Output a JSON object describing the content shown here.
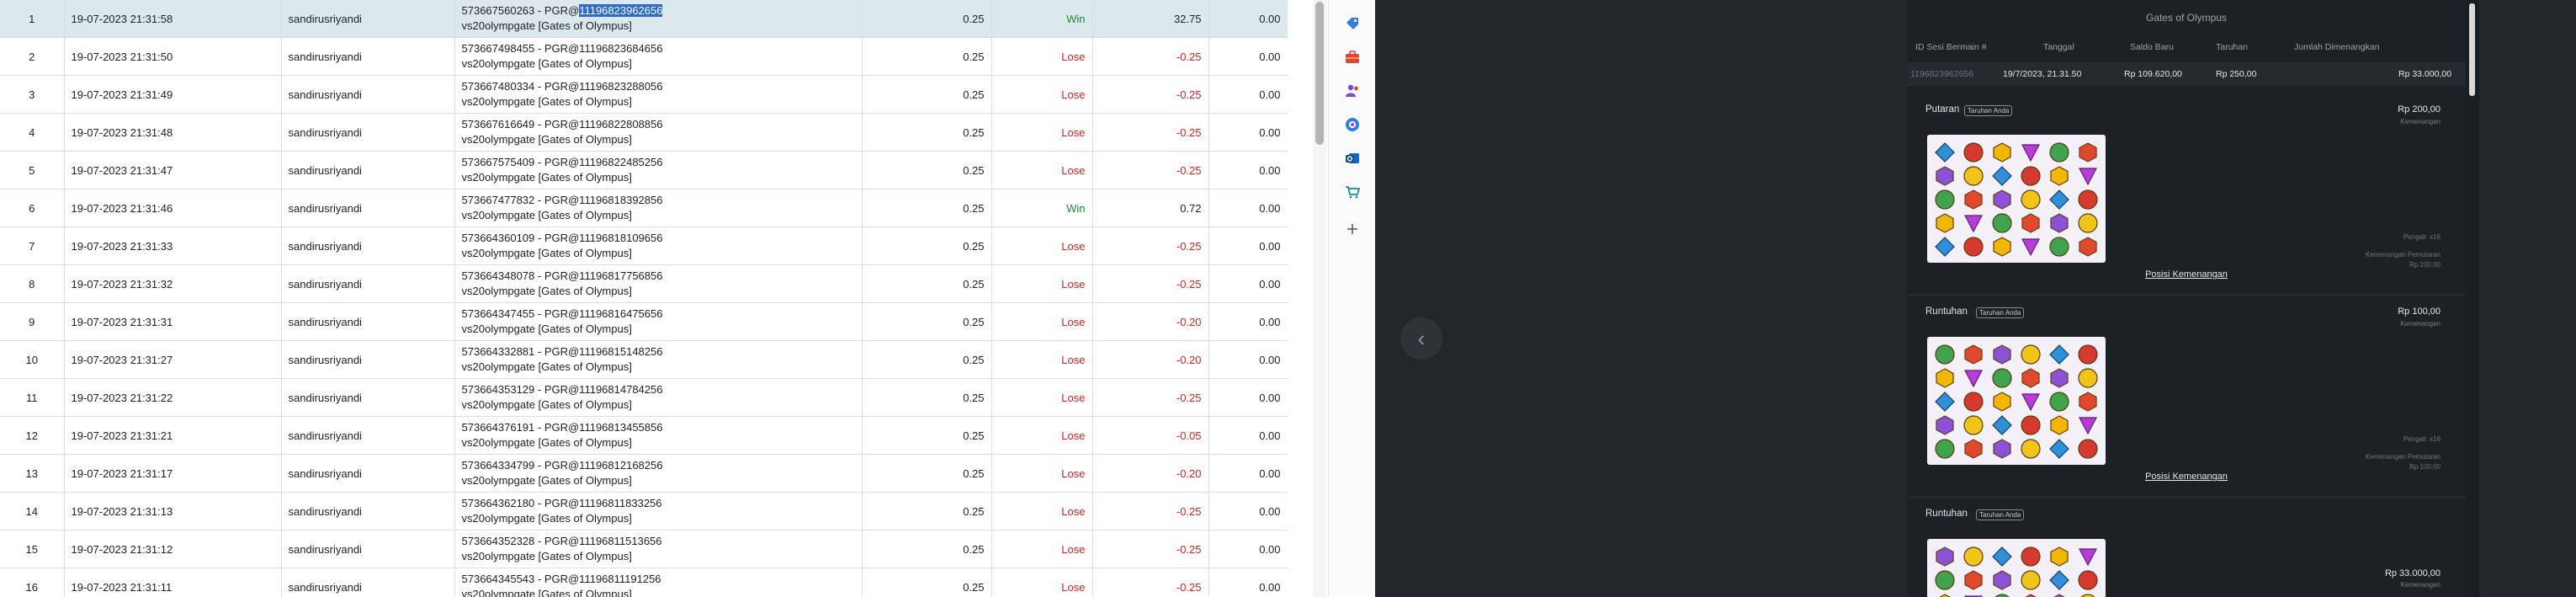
{
  "table": {
    "rows": [
      {
        "no": "1",
        "date": "19-07-2023 21:31:58",
        "user": "sandirusriyandi",
        "game_pre": "573667560263 - PGR@",
        "game_hl": "11196823962656",
        "game_post": "",
        "game_line2": "vs20olympgate [Gates of Olympus]",
        "bet": "0.25",
        "result": "Win",
        "amount": "32.75",
        "balance": "0.00"
      },
      {
        "no": "2",
        "date": "19-07-2023 21:31:50",
        "user": "sandirusriyandi",
        "game_pre": "573667498455 - PGR@11196823684656",
        "game_hl": "",
        "game_post": "",
        "game_line2": "vs20olympgate [Gates of Olympus]",
        "bet": "0.25",
        "result": "Lose",
        "amount": "-0.25",
        "balance": "0.00"
      },
      {
        "no": "3",
        "date": "19-07-2023 21:31:49",
        "user": "sandirusriyandi",
        "game_pre": "573667480334 - PGR@11196823288056",
        "game_hl": "",
        "game_post": "",
        "game_line2": "vs20olympgate [Gates of Olympus]",
        "bet": "0.25",
        "result": "Lose",
        "amount": "-0.25",
        "balance": "0.00"
      },
      {
        "no": "4",
        "date": "19-07-2023 21:31:48",
        "user": "sandirusriyandi",
        "game_pre": "573667616649 - PGR@11196822808856",
        "game_hl": "",
        "game_post": "",
        "game_line2": "vs20olympgate [Gates of Olympus]",
        "bet": "0.25",
        "result": "Lose",
        "amount": "-0.25",
        "balance": "0.00"
      },
      {
        "no": "5",
        "date": "19-07-2023 21:31:47",
        "user": "sandirusriyandi",
        "game_pre": "573667575409 - PGR@11196822485256",
        "game_hl": "",
        "game_post": "",
        "game_line2": "vs20olympgate [Gates of Olympus]",
        "bet": "0.25",
        "result": "Lose",
        "amount": "-0.25",
        "balance": "0.00"
      },
      {
        "no": "6",
        "date": "19-07-2023 21:31:46",
        "user": "sandirusriyandi",
        "game_pre": "573667477832 - PGR@11196818392856",
        "game_hl": "",
        "game_post": "",
        "game_line2": "vs20olympgate [Gates of Olympus]",
        "bet": "0.25",
        "result": "Win",
        "amount": "0.72",
        "balance": "0.00"
      },
      {
        "no": "7",
        "date": "19-07-2023 21:31:33",
        "user": "sandirusriyandi",
        "game_pre": "573664360109 - PGR@11196818109656",
        "game_hl": "",
        "game_post": "",
        "game_line2": "vs20olympgate [Gates of Olympus]",
        "bet": "0.25",
        "result": "Lose",
        "amount": "-0.25",
        "balance": "0.00"
      },
      {
        "no": "8",
        "date": "19-07-2023 21:31:32",
        "user": "sandirusriyandi",
        "game_pre": "573664348078 - PGR@11196817756856",
        "game_hl": "",
        "game_post": "",
        "game_line2": "vs20olympgate [Gates of Olympus]",
        "bet": "0.25",
        "result": "Lose",
        "amount": "-0.25",
        "balance": "0.00"
      },
      {
        "no": "9",
        "date": "19-07-2023 21:31:31",
        "user": "sandirusriyandi",
        "game_pre": "573664347455 - PGR@11196816475656",
        "game_hl": "",
        "game_post": "",
        "game_line2": "vs20olympgate [Gates of Olympus]",
        "bet": "0.25",
        "result": "Lose",
        "amount": "-0.20",
        "balance": "0.00"
      },
      {
        "no": "10",
        "date": "19-07-2023 21:31:27",
        "user": "sandirusriyandi",
        "game_pre": "573664332881 - PGR@11196815148256",
        "game_hl": "",
        "game_post": "",
        "game_line2": "vs20olympgate [Gates of Olympus]",
        "bet": "0.25",
        "result": "Lose",
        "amount": "-0.20",
        "balance": "0.00"
      },
      {
        "no": "11",
        "date": "19-07-2023 21:31:22",
        "user": "sandirusriyandi",
        "game_pre": "573664353129 - PGR@11196814784256",
        "game_hl": "",
        "game_post": "",
        "game_line2": "vs20olympgate [Gates of Olympus]",
        "bet": "0.25",
        "result": "Lose",
        "amount": "-0.25",
        "balance": "0.00"
      },
      {
        "no": "12",
        "date": "19-07-2023 21:31:21",
        "user": "sandirusriyandi",
        "game_pre": "573664376191 - PGR@11196813455856",
        "game_hl": "",
        "game_post": "",
        "game_line2": "vs20olympgate [Gates of Olympus]",
        "bet": "0.25",
        "result": "Lose",
        "amount": "-0.05",
        "balance": "0.00"
      },
      {
        "no": "13",
        "date": "19-07-2023 21:31:17",
        "user": "sandirusriyandi",
        "game_pre": "573664334799 - PGR@11196812168256",
        "game_hl": "",
        "game_post": "",
        "game_line2": "vs20olympgate [Gates of Olympus]",
        "bet": "0.25",
        "result": "Lose",
        "amount": "-0.20",
        "balance": "0.00"
      },
      {
        "no": "14",
        "date": "19-07-2023 21:31:13",
        "user": "sandirusriyandi",
        "game_pre": "573664362180 - PGR@11196811833256",
        "game_hl": "",
        "game_post": "",
        "game_line2": "vs20olympgate [Gates of Olympus]",
        "bet": "0.25",
        "result": "Lose",
        "amount": "-0.25",
        "balance": "0.00"
      },
      {
        "no": "15",
        "date": "19-07-2023 21:31:12",
        "user": "sandirusriyandi",
        "game_pre": "573664352328 - PGR@11196811513656",
        "game_hl": "",
        "game_post": "",
        "game_line2": "vs20olympgate [Gates of Olympus]",
        "bet": "0.25",
        "result": "Lose",
        "amount": "-0.25",
        "balance": "0.00"
      },
      {
        "no": "16",
        "date": "19-07-2023 21:31:11",
        "user": "sandirusriyandi",
        "game_pre": "573664345543 - PGR@11196811191256",
        "game_hl": "",
        "game_post": "",
        "game_line2": "vs20olympgate [Gates of Olympus]",
        "bet": "0.25",
        "result": "Lose",
        "amount": "-0.25",
        "balance": "0.00"
      }
    ]
  },
  "sidebar": {
    "icons": [
      "tag-icon",
      "toolbox-icon",
      "people-icon",
      "copilot-icon",
      "outlook-icon",
      "shopping-icon",
      "add-icon"
    ]
  },
  "game": {
    "title": "Gates of Olympus",
    "headers": [
      "ID Sesi Bermain #",
      "Tanggal",
      "Saldo Baru",
      "Taruhan",
      "Jumlah Dimenangkan"
    ],
    "info": [
      "1196823962656",
      "19/7/2023, 21.31.50",
      "Rp 109.620,00",
      "Rp 250,00",
      "Rp 33.000,00"
    ],
    "sections": [
      {
        "title": "Putaran",
        "badge": "Taruhan Anda",
        "amount": "Rp 200,00",
        "amount_sub": "Kemenangan",
        "link": "Posisi Kemenangan",
        "note1": "Pengali: x16",
        "note2": "Kemenangan Pemutaran",
        "note3": "Rp 200,00"
      },
      {
        "title": "Runtuhan",
        "badge": "Taruhan Anda",
        "amount": "Rp 100,00",
        "amount_sub": "Kemenangan",
        "link": "Posisi Kemenangan",
        "note1": "Pengali: x16",
        "note2": "Kemenangan Pemutaran",
        "note3": "Rp 100,00"
      },
      {
        "title": "Runtuhan",
        "badge": "Taruhan Anda",
        "amount": "Rp 33.000,00",
        "amount_sub": "Kemenangan"
      }
    ],
    "nav_prev": "‹"
  },
  "colors": {
    "win": "#1e8a2e",
    "lose": "#e01e1e",
    "selected_row": "#dbe9ef",
    "highlight": "#2d6ac9",
    "panel_bg": "#1d2024"
  }
}
